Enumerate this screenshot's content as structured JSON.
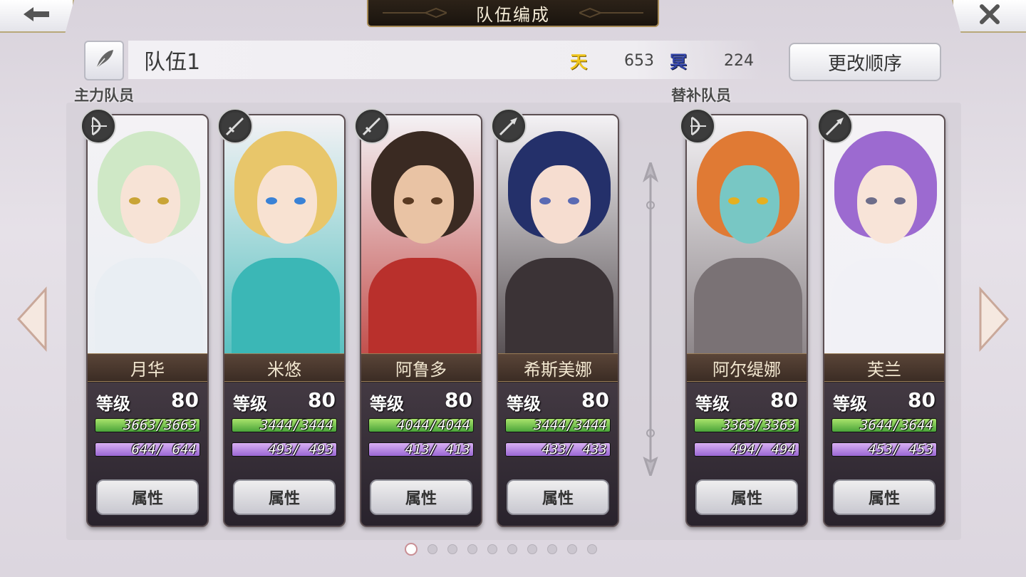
{
  "header": {
    "title": "队伍编成",
    "back_icon": "back-arrow-icon",
    "close_icon": "close-icon"
  },
  "team": {
    "name": "队伍1",
    "heaven_icon": "天",
    "heaven_value": "653",
    "underworld_icon": "冥",
    "underworld_value": "224",
    "reorder_label": "更改顺序",
    "edit_icon": "quill-icon"
  },
  "sections": {
    "main_label": "主力队员",
    "sub_label": "替补队员"
  },
  "level_label": "等级",
  "attr_label": "属性",
  "members": [
    {
      "name": "月华",
      "level": "80",
      "hp": "3663/3663",
      "mp": " 644/ 644",
      "weapon": "bow-icon",
      "hair": "#cfe8c6",
      "skin": "#f7e3d6",
      "eye": "#c9a436",
      "outfit": "#e9eef3"
    },
    {
      "name": "米悠",
      "level": "80",
      "hp": "3444/3444",
      "mp": " 493/ 493",
      "weapon": "sword-icon",
      "hair": "#e8c66a",
      "skin": "#f8e2d2",
      "eye": "#3a82d6",
      "outfit": "#3bb7b6"
    },
    {
      "name": "阿鲁多",
      "level": "80",
      "hp": "4044/4044",
      "mp": " 413/ 413",
      "weapon": "sword-icon",
      "hair": "#3a2a22",
      "skin": "#e9c3a4",
      "eye": "#5a3a22",
      "outfit": "#b9302c"
    },
    {
      "name": "希斯美娜",
      "level": "80",
      "hp": "3444/3444",
      "mp": " 433/ 433",
      "weapon": "spear-icon",
      "hair": "#24306a",
      "skin": "#f6ddd0",
      "eye": "#5a6ab3",
      "outfit": "#3b3336"
    },
    {
      "name": "阿尔缇娜",
      "level": "80",
      "hp": "3363/3363",
      "mp": " 494/ 494",
      "weapon": "bow-icon",
      "hair": "#e07a34",
      "skin": "#78c7c4",
      "eye": "#e5b020",
      "outfit": "#7a7275"
    },
    {
      "name": "芙兰",
      "level": "80",
      "hp": "3644/3644",
      "mp": " 453/ 453",
      "weapon": "spear-icon",
      "hair": "#9c6ad0",
      "skin": "#f8e4d8",
      "eye": "#6d6d8a",
      "outfit": "#f1f1f6"
    }
  ],
  "pager": {
    "count": 10,
    "active": 0
  }
}
